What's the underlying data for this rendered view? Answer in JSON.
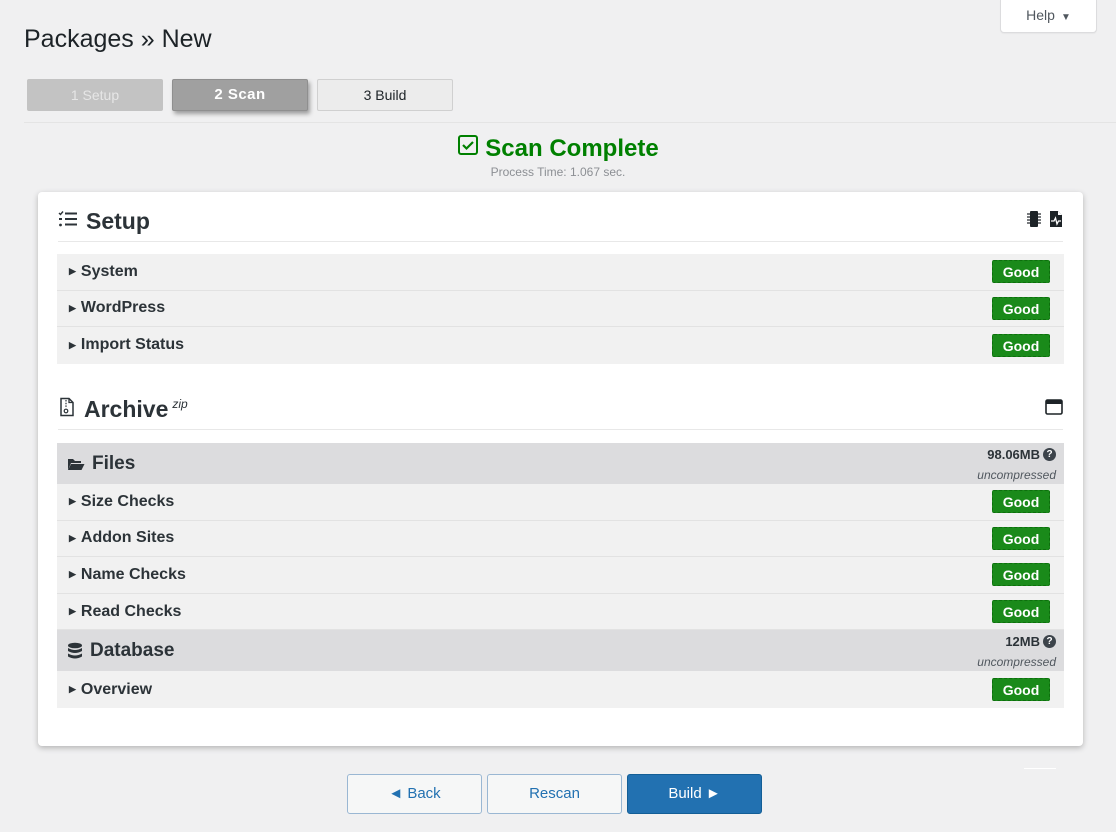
{
  "help": {
    "label": "Help",
    "caret": "▼"
  },
  "page_title": "Packages » New",
  "steps": [
    {
      "label": "1 Setup",
      "state": "done"
    },
    {
      "label": "2 Scan",
      "state": "active"
    },
    {
      "label": "3 Build",
      "state": "todo"
    }
  ],
  "scan": {
    "title": "Scan Complete",
    "process_time": "Process Time: 1.067 sec.",
    "color": "#008000"
  },
  "setup": {
    "title": "Setup",
    "rows": [
      {
        "label": "System",
        "status": "Good"
      },
      {
        "label": "WordPress",
        "status": "Good"
      },
      {
        "label": "Import Status",
        "status": "Good"
      }
    ]
  },
  "archive": {
    "title": "Archive",
    "format": "zip",
    "files": {
      "title": "Files",
      "size": "98.06MB",
      "size_note": "uncompressed",
      "rows": [
        {
          "label": "Size Checks",
          "status": "Good"
        },
        {
          "label": "Addon Sites",
          "status": "Good"
        },
        {
          "label": "Name Checks",
          "status": "Good"
        },
        {
          "label": "Read Checks",
          "status": "Good"
        }
      ]
    },
    "database": {
      "title": "Database",
      "size": "12MB",
      "size_note": "uncompressed",
      "rows": [
        {
          "label": "Overview",
          "status": "Good"
        }
      ]
    }
  },
  "buttons": {
    "back": "◄ Back",
    "rescan": "Rescan",
    "build": "Build ►"
  },
  "colors": {
    "good": "#1a8a1a",
    "primary": "#2271b1"
  }
}
